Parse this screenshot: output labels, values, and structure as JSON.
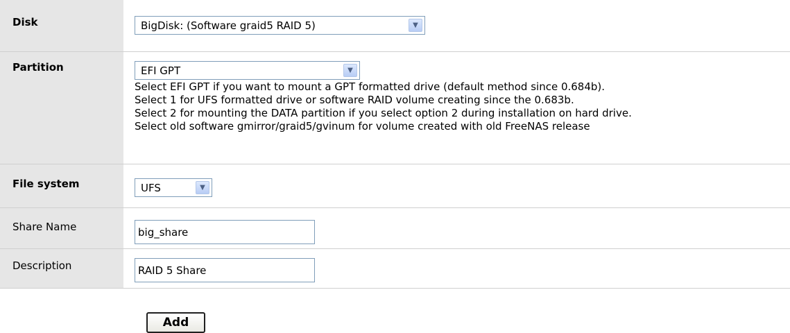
{
  "form": {
    "disk": {
      "label": "Disk",
      "value": "BigDisk: (Software graid5 RAID 5)"
    },
    "partition": {
      "label": "Partition",
      "value": "EFI GPT",
      "help": [
        "Select EFI GPT if you want to mount a GPT formatted drive (default method since 0.684b).",
        "Select 1 for UFS formatted drive or software RAID volume creating since the 0.683b.",
        "Select 2 for mounting the DATA partition if you select option 2 during installation on hard drive.",
        "Select old software gmirror/graid5/gvinum for volume created with old FreeNAS release"
      ]
    },
    "filesystem": {
      "label": "File system",
      "value": "UFS"
    },
    "share_name": {
      "label": "Share Name",
      "value": "big_share"
    },
    "description": {
      "label": "Description",
      "value": "RAID 5 Share"
    },
    "add_label": "Add"
  },
  "icons": {
    "dropdown": "chevron-down-icon"
  }
}
